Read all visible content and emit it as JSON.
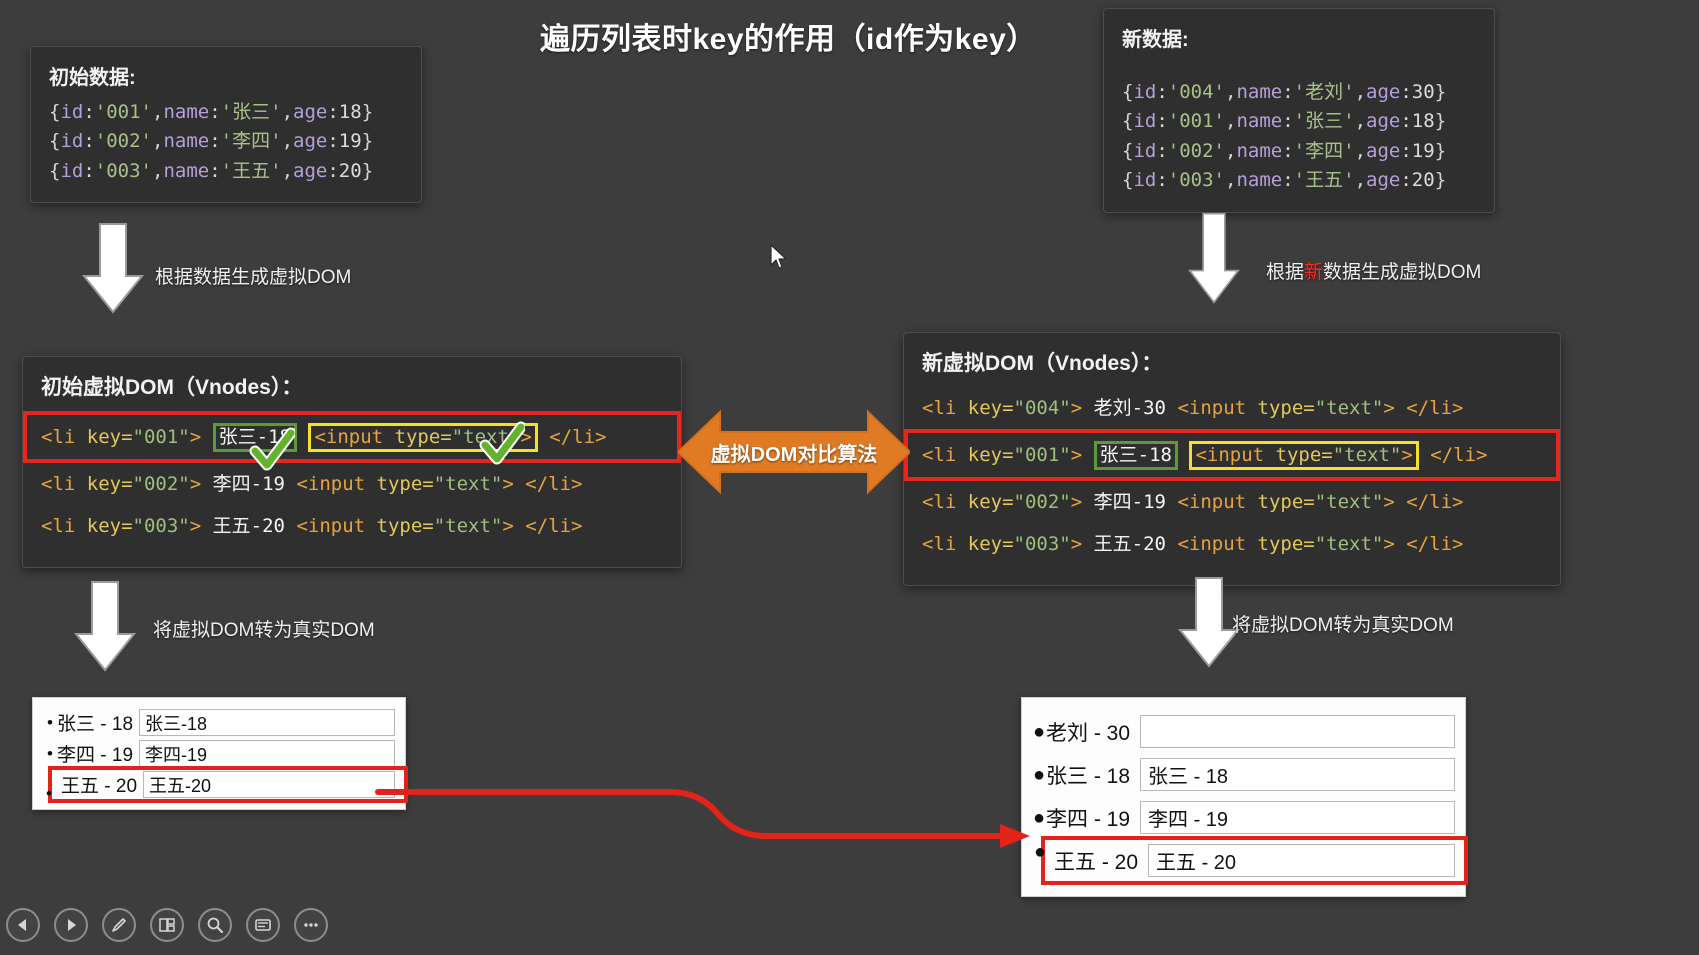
{
  "page": {
    "title": "遍历列表时key的作用（id作为key）",
    "background": "#3d3d3d",
    "accent_red": "#e8251a",
    "accent_orange": "#e07b24",
    "accent_green": "#5d9b3a",
    "accent_yellow": "#f2e02a"
  },
  "initial_data": {
    "heading": "初始数据:",
    "rows": [
      {
        "open": "{",
        "k1": "id",
        "c1": ":",
        "v1": "'001'",
        "comma1": ",",
        "k2": "name",
        "c2": ":",
        "v2": "'张三'",
        "comma2": ",",
        "k3": "age",
        "c3": ":",
        "v3": "18",
        "close": "}"
      },
      {
        "open": "{",
        "k1": "id",
        "c1": ":",
        "v1": "'002'",
        "comma1": ",",
        "k2": "name",
        "c2": ":",
        "v2": "'李四'",
        "comma2": ",",
        "k3": "age",
        "c3": ":",
        "v3": "19",
        "close": "}"
      },
      {
        "open": "{",
        "k1": "id",
        "c1": ":",
        "v1": "'003'",
        "comma1": ",",
        "k2": "name",
        "c2": ":",
        "v2": "'王五'",
        "comma2": ",",
        "k3": "age",
        "c3": ":",
        "v3": "20",
        "close": "}"
      }
    ]
  },
  "new_data": {
    "heading": "新数据:",
    "rows": [
      {
        "open": "{",
        "k1": "id",
        "c1": ":",
        "v1": "'004'",
        "comma1": ",",
        "k2": "name",
        "c2": ":",
        "v2": "'老刘'",
        "comma2": ",",
        "k3": "age",
        "c3": ":",
        "v3": "30",
        "close": "}"
      },
      {
        "open": "{",
        "k1": "id",
        "c1": ":",
        "v1": "'001'",
        "comma1": ",",
        "k2": "name",
        "c2": ":",
        "v2": "'张三'",
        "comma2": ",",
        "k3": "age",
        "c3": ":",
        "v3": "18",
        "close": "}"
      },
      {
        "open": "{",
        "k1": "id",
        "c1": ":",
        "v1": "'002'",
        "comma1": ",",
        "k2": "name",
        "c2": ":",
        "v2": "'李四'",
        "comma2": ",",
        "k3": "age",
        "c3": ":",
        "v3": "19",
        "close": "}"
      },
      {
        "open": "{",
        "k1": "id",
        "c1": ":",
        "v1": "'003'",
        "comma1": ",",
        "k2": "name",
        "c2": ":",
        "v2": "'王五'",
        "comma2": ",",
        "k3": "age",
        "c3": ":",
        "v3": "20",
        "close": "}"
      }
    ]
  },
  "flow_labels": {
    "left_top": "根据数据生成虚拟DOM",
    "right_top_a": "根据",
    "right_top_highlight": "新",
    "right_top_b": "数据生成虚拟DOM",
    "left_bottom": "将虚拟DOM转为真实DOM",
    "right_bottom": "将虚拟DOM转为真实DOM"
  },
  "initial_vdom": {
    "heading": "初始虚拟DOM（Vnodes）：",
    "rows": [
      {
        "tag_open": "<li",
        "attr": "key=",
        "key": "\"001\"",
        "gt": ">",
        "content": "张三-18",
        "input_open": "<input",
        "input_attr": "type=",
        "input_val": "\"text\"",
        "input_gt": ">",
        "close": "</li>",
        "highlight": "red",
        "content_box": "green",
        "input_box": "yellow",
        "check": true
      },
      {
        "tag_open": "<li",
        "attr": "key=",
        "key": "\"002\"",
        "gt": ">",
        "content": "李四-19",
        "input_open": "<input",
        "input_attr": "type=",
        "input_val": "\"text\"",
        "input_gt": ">",
        "close": "</li>",
        "highlight": "none",
        "content_box": "none",
        "input_box": "none",
        "check": false
      },
      {
        "tag_open": "<li",
        "attr": "key=",
        "key": "\"003\"",
        "gt": ">",
        "content": "王五-20",
        "input_open": "<input",
        "input_attr": "type=",
        "input_val": "\"text\"",
        "input_gt": ">",
        "close": "</li>",
        "highlight": "none",
        "content_box": "none",
        "input_box": "none",
        "check": false
      }
    ]
  },
  "new_vdom": {
    "heading": "新虚拟DOM（Vnodes）：",
    "rows": [
      {
        "tag_open": "<li",
        "attr": "key=",
        "key": "\"004\"",
        "gt": ">",
        "content": "老刘-30",
        "input_open": "<input",
        "input_attr": "type=",
        "input_val": "\"text\"",
        "input_gt": ">",
        "close": "</li>",
        "highlight": "none",
        "content_box": "none",
        "input_box": "none"
      },
      {
        "tag_open": "<li",
        "attr": "key=",
        "key": "\"001\"",
        "gt": ">",
        "content": "张三-18",
        "input_open": "<input",
        "input_attr": "type=",
        "input_val": "\"text\"",
        "input_gt": ">",
        "close": "</li>",
        "highlight": "red",
        "content_box": "green",
        "input_box": "yellow"
      },
      {
        "tag_open": "<li",
        "attr": "key=",
        "key": "\"002\"",
        "gt": ">",
        "content": "李四-19",
        "input_open": "<input",
        "input_attr": "type=",
        "input_val": "\"text\"",
        "input_gt": ">",
        "close": "</li>",
        "highlight": "none",
        "content_box": "none",
        "input_box": "none"
      },
      {
        "tag_open": "<li",
        "attr": "key=",
        "key": "\"003\"",
        "gt": ">",
        "content": "王五-20",
        "input_open": "<input",
        "input_attr": "type=",
        "input_val": "\"text\"",
        "input_gt": ">",
        "close": "</li>",
        "highlight": "none",
        "content_box": "none",
        "input_box": "none"
      }
    ]
  },
  "compare_arrow": {
    "label": "虚拟DOM对比算法"
  },
  "dom_left": {
    "rows": [
      {
        "bullet": "•",
        "label": "张三 - 18",
        "input_value": "张三-18",
        "highlight": false
      },
      {
        "bullet": "•",
        "label": "李四 - 19",
        "input_value": "李四-19",
        "highlight": false
      },
      {
        "bullet": "•",
        "label": "王五 - 20",
        "input_value": "王五-20",
        "highlight": true
      }
    ]
  },
  "dom_right": {
    "rows": [
      {
        "bullet": "●",
        "label": "老刘 - 30",
        "input_value": "",
        "highlight": false
      },
      {
        "bullet": "●",
        "label": "张三 - 18",
        "input_value": "张三 - 18",
        "highlight": false
      },
      {
        "bullet": "●",
        "label": "李四 - 19",
        "input_value": "李四 - 19",
        "highlight": false
      },
      {
        "bullet": "●",
        "label": "王五 - 20",
        "input_value": "王五 - 20",
        "highlight": true
      }
    ]
  },
  "toolbar": {
    "items": [
      {
        "icon": "previous-slide-icon",
        "label": "上一页"
      },
      {
        "icon": "next-slide-icon",
        "label": "下一页"
      },
      {
        "icon": "pen-icon",
        "label": "画笔"
      },
      {
        "icon": "layout-icon",
        "label": "版式"
      },
      {
        "icon": "magnifier-icon",
        "label": "放大"
      },
      {
        "icon": "screen-icon",
        "label": "屏幕"
      },
      {
        "icon": "more-icon",
        "label": "更多"
      }
    ]
  }
}
